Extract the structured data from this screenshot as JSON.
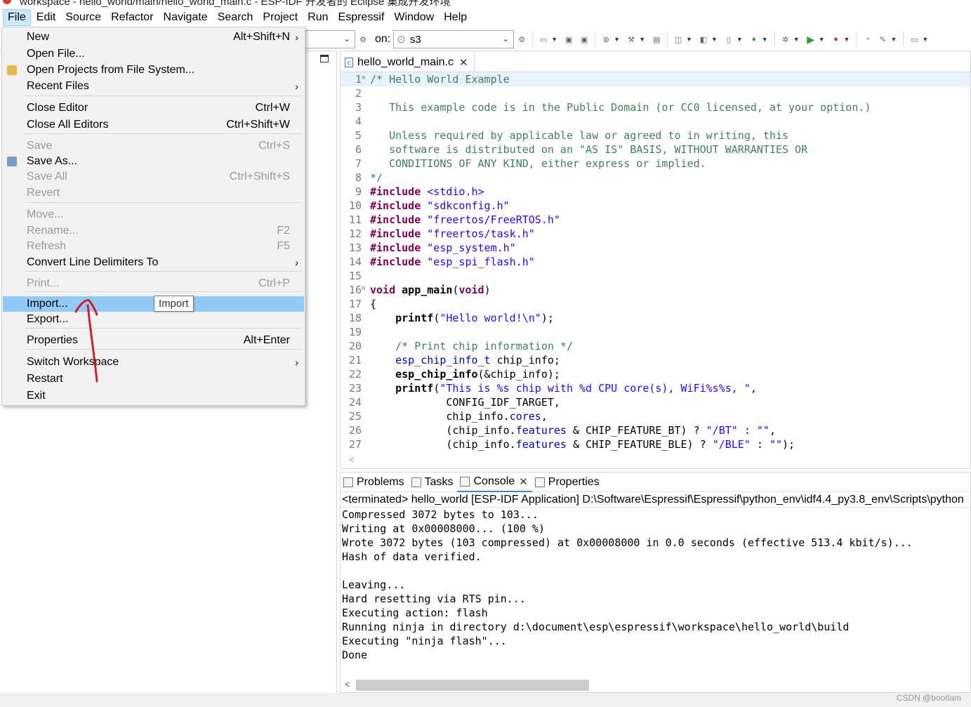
{
  "window": {
    "title": "workspace - hello_world/main/hello_world_main.c - ESP-IDF 开发者的 Eclipse 集成开发环境"
  },
  "menubar": [
    "File",
    "Edit",
    "Source",
    "Refactor",
    "Navigate",
    "Search",
    "Project",
    "Run",
    "Espressif",
    "Window",
    "Help"
  ],
  "toolbar": {
    "on_label": "on:",
    "target_value": "s3"
  },
  "file_menu": {
    "items": [
      {
        "label": "New",
        "shortcut": "Alt+Shift+N",
        "submenu": true
      },
      {
        "label": "Open File..."
      },
      {
        "label": "Open Projects from File System...",
        "icon": "open-folder-icon"
      },
      {
        "label": "Recent Files",
        "submenu": true
      },
      {
        "label": "Close Editor",
        "shortcut": "Ctrl+W"
      },
      {
        "label": "Close All Editors",
        "shortcut": "Ctrl+Shift+W"
      },
      {
        "label": "Save",
        "shortcut": "Ctrl+S",
        "disabled": true
      },
      {
        "label": "Save As...",
        "icon": "save-as-icon"
      },
      {
        "label": "Save All",
        "shortcut": "Ctrl+Shift+S",
        "disabled": true
      },
      {
        "label": "Revert",
        "disabled": true
      },
      {
        "label": "Move...",
        "disabled": true
      },
      {
        "label": "Rename...",
        "shortcut": "F2",
        "disabled": true
      },
      {
        "label": "Refresh",
        "shortcut": "F5",
        "disabled": true
      },
      {
        "label": "Convert Line Delimiters To",
        "submenu": true
      },
      {
        "label": "Print...",
        "shortcut": "Ctrl+P",
        "disabled": true
      },
      {
        "label": "Import...",
        "selected": true
      },
      {
        "label": "Export..."
      },
      {
        "label": "Properties",
        "shortcut": "Alt+Enter"
      },
      {
        "label": "Switch Workspace",
        "submenu": true
      },
      {
        "label": "Restart"
      },
      {
        "label": "Exit"
      }
    ],
    "tooltip": "Import"
  },
  "editor": {
    "tab_title": "hello_world_main.c",
    "lines": [
      {
        "n": "1",
        "fold": "⊖",
        "hl": true,
        "parts": [
          [
            "c-com",
            "/* Hello World Example"
          ]
        ]
      },
      {
        "n": "2",
        "parts": []
      },
      {
        "n": "3",
        "parts": [
          [
            "c-com",
            "   This example code is in the Public Domain (or CC0 licensed, at your option.)"
          ]
        ]
      },
      {
        "n": "4",
        "parts": []
      },
      {
        "n": "5",
        "parts": [
          [
            "c-com",
            "   Unless required by applicable law or agreed to in writing, this"
          ]
        ]
      },
      {
        "n": "6",
        "parts": [
          [
            "c-com",
            "   software is distributed on an \"AS IS\" BASIS, WITHOUT WARRANTIES OR"
          ]
        ]
      },
      {
        "n": "7",
        "parts": [
          [
            "c-com",
            "   CONDITIONS OF ANY KIND, either express or implied."
          ]
        ]
      },
      {
        "n": "8",
        "parts": [
          [
            "c-com",
            "*/"
          ]
        ]
      },
      {
        "n": "9",
        "parts": [
          [
            "c-kw",
            "#include"
          ],
          [
            "",
            " "
          ],
          [
            "c-str",
            "<stdio.h>"
          ]
        ]
      },
      {
        "n": "10",
        "parts": [
          [
            "c-kw",
            "#include"
          ],
          [
            "",
            " "
          ],
          [
            "c-str",
            "\"sdkconfig.h\""
          ]
        ]
      },
      {
        "n": "11",
        "parts": [
          [
            "c-kw",
            "#include"
          ],
          [
            "",
            " "
          ],
          [
            "c-str",
            "\"freertos/FreeRTOS.h\""
          ]
        ]
      },
      {
        "n": "12",
        "parts": [
          [
            "c-kw",
            "#include"
          ],
          [
            "",
            " "
          ],
          [
            "c-str",
            "\"freertos/task.h\""
          ]
        ]
      },
      {
        "n": "13",
        "parts": [
          [
            "c-kw",
            "#include"
          ],
          [
            "",
            " "
          ],
          [
            "c-str",
            "\"esp_system.h\""
          ]
        ]
      },
      {
        "n": "14",
        "parts": [
          [
            "c-kw",
            "#include"
          ],
          [
            "",
            " "
          ],
          [
            "c-str",
            "\"esp_spi_flash.h\""
          ]
        ]
      },
      {
        "n": "15",
        "parts": []
      },
      {
        "n": "16",
        "fold": "⊖",
        "parts": [
          [
            "c-kw",
            "void"
          ],
          [
            "",
            " "
          ],
          [
            "c-fn",
            "app_main"
          ],
          [
            "",
            "("
          ],
          [
            "c-kw",
            "void"
          ],
          [
            "",
            ")"
          ]
        ]
      },
      {
        "n": "17",
        "parts": [
          [
            "",
            "{"
          ]
        ]
      },
      {
        "n": "18",
        "parts": [
          [
            "",
            "    "
          ],
          [
            "c-fn",
            "printf"
          ],
          [
            "",
            "("
          ],
          [
            "c-str",
            "\"Hello world!\\n\""
          ],
          [
            "",
            ");"
          ]
        ]
      },
      {
        "n": "19",
        "parts": []
      },
      {
        "n": "20",
        "parts": [
          [
            "",
            "    "
          ],
          [
            "c-com",
            "/* Print chip information */"
          ]
        ]
      },
      {
        "n": "21",
        "parts": [
          [
            "",
            "    "
          ],
          [
            "c-mem",
            "esp_chip_info_t"
          ],
          [
            "",
            " chip_info;"
          ]
        ]
      },
      {
        "n": "22",
        "parts": [
          [
            "",
            "    "
          ],
          [
            "c-fn",
            "esp_chip_info"
          ],
          [
            "",
            "(&chip_info);"
          ]
        ]
      },
      {
        "n": "23",
        "parts": [
          [
            "",
            "    "
          ],
          [
            "c-fn",
            "printf"
          ],
          [
            "",
            "("
          ],
          [
            "c-str",
            "\"This is %s chip with %d CPU core(s), WiFi%s%s, \""
          ],
          [
            "",
            ","
          ]
        ]
      },
      {
        "n": "24",
        "parts": [
          [
            "",
            "            CONFIG_IDF_TARGET,"
          ]
        ]
      },
      {
        "n": "25",
        "parts": [
          [
            "",
            "            chip_info."
          ],
          [
            "c-mem",
            "cores"
          ],
          [
            "",
            ","
          ]
        ]
      },
      {
        "n": "26",
        "parts": [
          [
            "",
            "            (chip_info."
          ],
          [
            "c-mem",
            "features"
          ],
          [
            "",
            " & CHIP_FEATURE_BT) ? "
          ],
          [
            "c-str",
            "\"/BT\""
          ],
          [
            "",
            " : "
          ],
          [
            "c-str",
            "\"\""
          ],
          [
            "",
            ","
          ]
        ]
      },
      {
        "n": "27",
        "parts": [
          [
            "",
            "            (chip_info."
          ],
          [
            "c-mem",
            "features"
          ],
          [
            "",
            " & CHIP_FEATURE_BLE) ? "
          ],
          [
            "c-str",
            "\"/BLE\""
          ],
          [
            "",
            " : "
          ],
          [
            "c-str",
            "\"\""
          ],
          [
            "",
            ");"
          ]
        ]
      }
    ]
  },
  "bottom_panel": {
    "tabs": [
      {
        "label": "Problems",
        "icon": "problems-icon"
      },
      {
        "label": "Tasks",
        "icon": "tasks-icon"
      },
      {
        "label": "Console",
        "icon": "console-icon",
        "active": true,
        "closable": true
      },
      {
        "label": "Properties",
        "icon": "properties-icon"
      }
    ],
    "console_header": "<terminated> hello_world [ESP-IDF Application] D:\\Software\\Espressif\\Espressif\\python_env\\idf4.4_py3.8_env\\Scripts\\python",
    "console_lines": [
      "Compressed 3072 bytes to 103...",
      "Writing at 0x00008000... (100 %)",
      "Wrote 3072 bytes (103 compressed) at 0x00008000 in 0.0 seconds (effective 513.4 kbit/s)...",
      "Hash of data verified.",
      "",
      "Leaving...",
      "Hard resetting via RTS pin...",
      "Executing action: flash",
      "Running ninja in directory d:\\document\\esp\\espressif\\workspace\\hello_world\\build",
      "Executing \"ninja flash\"...",
      "Done"
    ]
  },
  "watermark": "CSDN @bootlam"
}
